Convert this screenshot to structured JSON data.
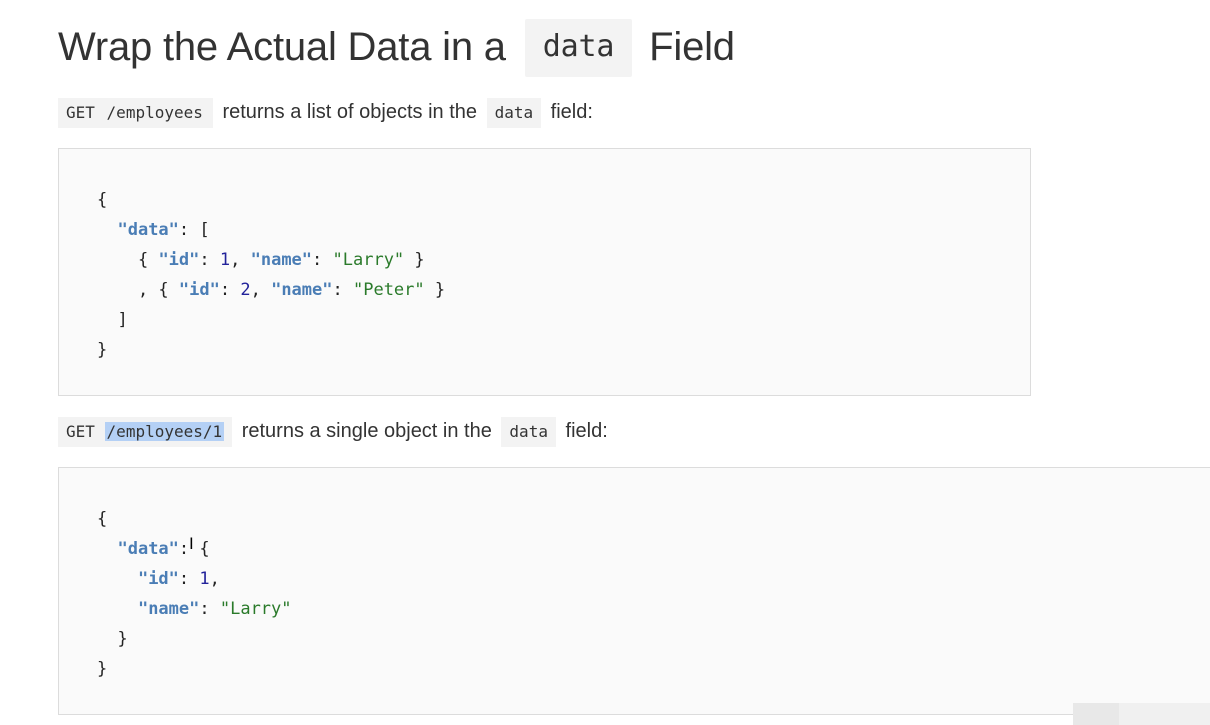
{
  "heading": {
    "prefix": "Wrap the Actual Data in a",
    "code": "data",
    "suffix": "Field"
  },
  "section1": {
    "method": "GET",
    "path": "/employees",
    "text": "returns a list of objects in the",
    "code": "data",
    "suffix": "field:",
    "code_block": {
      "open": "{",
      "data_key": "\"data\"",
      "array_open": "[",
      "row1": {
        "id": "1",
        "name": "\"Larry\""
      },
      "row2": {
        "id": "2",
        "name": "\"Peter\""
      },
      "id_key": "\"id\"",
      "name_key": "\"name\"",
      "array_close": "]",
      "close": "}"
    }
  },
  "section2": {
    "method": "GET",
    "path": "/employees/1",
    "path_selected": true,
    "text": "returns a single object in the",
    "code": "data",
    "suffix": "field:",
    "code_block": {
      "open": "{",
      "data_key": "\"data\"",
      "obj_open": "{",
      "id_key": "\"id\"",
      "id_val": "1",
      "name_key": "\"name\"",
      "name_val": "\"Larry\"",
      "obj_close": "}",
      "close": "}"
    }
  },
  "colors": {
    "key": "#4a7db5",
    "string": "#2a7a2a",
    "number": "#22229a",
    "selection": "#b4d0f5",
    "inline_code_bg": "#f3f3f3"
  },
  "icons": {
    "text_cursor": "text-cursor-icon"
  }
}
